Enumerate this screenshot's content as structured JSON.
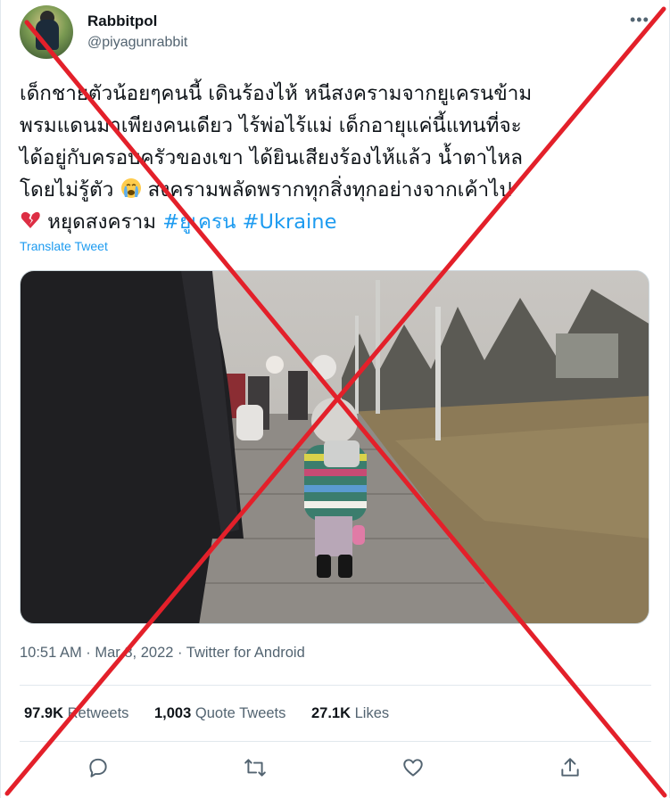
{
  "author": {
    "display_name": "Rabbitpol",
    "handle": "@piyagunrabbit",
    "avatar_icon": "avatar-photo"
  },
  "tweet": {
    "lines": [
      "เด็กชายตัวน้อยๆคนนี้ เดินร้องไห้ หนีสงครามจากยูเครนข้าม",
      "พรมแดนมาเพียงคนเดียว ไร้พ่อไร้แม่ เด็กอายุแค่นี้แทนที่จะ",
      "ได้อยู่กับครอบครัวของเขา  ได้ยินเสียงร้องไห้แล้ว น้ำตาไหล",
      "โดยไม่รู้ตัว",
      "สงครามพลัดพรากทุกสิ่งทุกอย่างจากเค้าไป",
      "หยุดสงคราม",
      "#ยูเครน",
      "#Ukraine"
    ],
    "emoji_1": "crying-face-emoji",
    "emoji_2": "broken-heart-emoji",
    "translate_label": "Translate Tweet"
  },
  "meta": {
    "text": "10:51 AM · Mar 8, 2022 · Twitter for Android"
  },
  "stats": {
    "retweets_count": "97.9K",
    "retweets_label": "Retweets",
    "quotes_count": "1,003",
    "quotes_label": "Quote Tweets",
    "likes_count": "27.1K",
    "likes_label": "Likes"
  },
  "actions": [
    "reply-icon",
    "retweet-icon",
    "like-icon",
    "share-icon"
  ],
  "colors": {
    "link": "#1d9bf0",
    "secondary": "#536471",
    "primary_text": "#0f1419",
    "cross": "#e3202a"
  }
}
